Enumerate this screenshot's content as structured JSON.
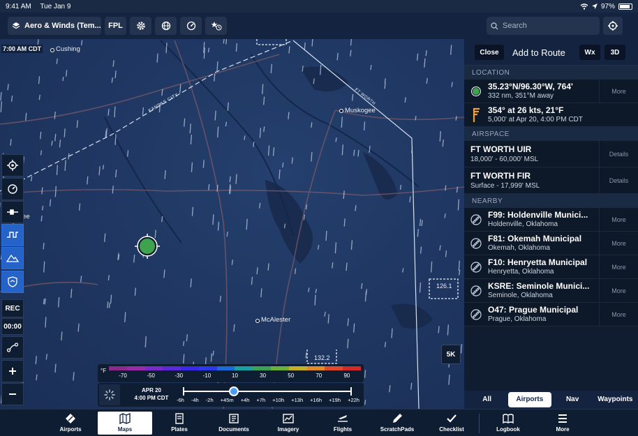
{
  "statusbar": {
    "time": "9:41 AM",
    "date": "Tue Jan 9",
    "battery": "97%"
  },
  "toolbar": {
    "layer_label": "Aero & Winds (Tem...",
    "fpl_label": "FPL",
    "search_placeholder": "Search"
  },
  "map": {
    "time_label": "7:00 AM CDT",
    "places": [
      "Cushing",
      "Muskogee",
      "Shawnee",
      "McAlester"
    ],
    "route_label_1": "KANSAS CITY",
    "route_label_2": "FT WORTH",
    "box_label_1": "126.1",
    "box_label_2": "132.2",
    "scale_button": "5K"
  },
  "left_controls": {
    "rec_label": "REC",
    "timer": "00:00"
  },
  "temp_legend": {
    "unit": "°F",
    "ticks": [
      "-70",
      "-50",
      "-30",
      "-10",
      "10",
      "30",
      "50",
      "70",
      "90"
    ],
    "colors": [
      "#8a2a8a",
      "#9a2aa8",
      "#7a2ac8",
      "#5a2ad8",
      "#3a2ae8",
      "#2a3ae8",
      "#1a6ad8",
      "#1aa0a0",
      "#3aa05a",
      "#6ab03a",
      "#c0b02a",
      "#e08a2a",
      "#e04a2a",
      "#d02a2a"
    ]
  },
  "timeline": {
    "date": "APR 20",
    "time": "4:00 PM CDT",
    "labels": [
      "-6h",
      "-4h",
      "-2h",
      "+45m",
      "+4h",
      "+7h",
      "+10h",
      "+13h",
      "+16h",
      "+19h",
      "+22h"
    ],
    "selected_index": 3
  },
  "panel": {
    "close_label": "Close",
    "title": "Add to Route",
    "wx_label": "Wx",
    "view3d_label": "3D",
    "location_header": "LOCATION",
    "location": [
      {
        "line1": "35.23°N/96.30°W, 764'",
        "line2": "332 nm, 351°M away",
        "action": "More"
      },
      {
        "line1": "354° at 26 kts, 21°F",
        "line2": "5,000' at Apr 20, 4:00 PM CDT"
      }
    ],
    "airspace_header": "AIRSPACE",
    "airspace": [
      {
        "line1": "FT WORTH UIR",
        "line2": "18,000' - 60,000' MSL",
        "action": "Details"
      },
      {
        "line1": "FT WORTH FIR",
        "line2": "Surface - 17,999' MSL",
        "action": "Details"
      }
    ],
    "nearby_header": "NEARBY",
    "nearby": [
      {
        "line1": "F99: Holdenville Munici...",
        "line2": "Holdenville, Oklahoma",
        "action": "More"
      },
      {
        "line1": "F81: Okemah Municipal",
        "line2": "Okemah, Oklahoma",
        "action": "More"
      },
      {
        "line1": "F10: Henryetta Municipal",
        "line2": "Henryetta, Oklahoma",
        "action": "More"
      },
      {
        "line1": "KSRE: Seminole Munici...",
        "line2": "Seminole, Oklahoma",
        "action": "More"
      },
      {
        "line1": "O47: Prague Municipal",
        "line2": "Prague, Oklahoma",
        "action": "More"
      }
    ],
    "tabs": [
      "All",
      "Airports",
      "Nav",
      "Waypoints"
    ],
    "selected_tab": "Airports"
  },
  "bottom_nav": {
    "items": [
      "Airports",
      "Maps",
      "Plates",
      "Documents",
      "Imagery",
      "Flights",
      "ScratchPads",
      "Checklist",
      "Logbook",
      "More"
    ],
    "selected": "Maps"
  },
  "colors": {
    "accent": "#2563c9",
    "marker": "#3fa34d",
    "wind_flag": "#f0a030"
  }
}
